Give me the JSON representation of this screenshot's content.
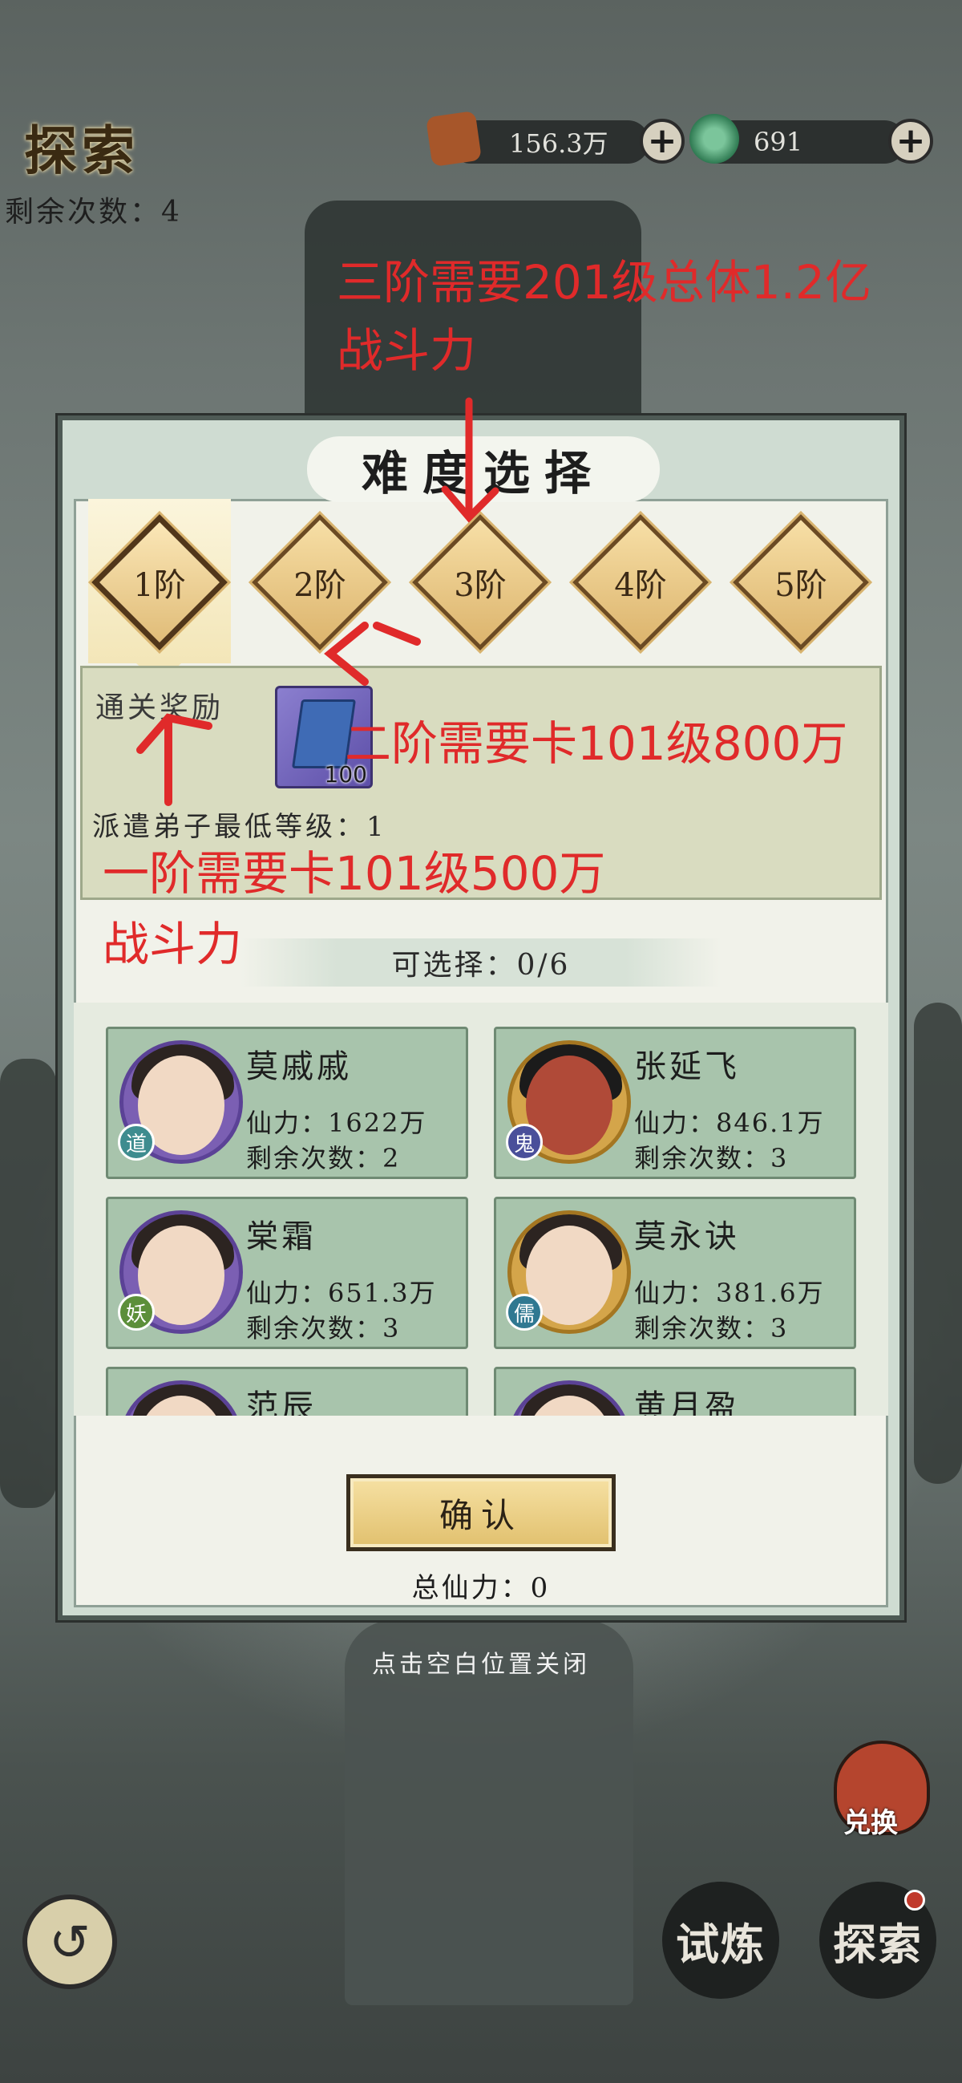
{
  "header": {
    "title": "探索",
    "remaining_label": "剩余次数：4",
    "resource1_value": "156.3万",
    "resource2_value": "691",
    "plus_symbol": "+"
  },
  "dialog": {
    "title": "难度选择",
    "tiers": [
      "1阶",
      "2阶",
      "3阶",
      "4阶",
      "5阶"
    ],
    "selected_tier": "1阶",
    "reward_label": "通关奖励",
    "reward_item_count": "100",
    "min_level_label": "派遣弟子最低等级：1",
    "selectable_label": "可选择：0/6",
    "characters": [
      {
        "name": "莫戚戚",
        "power": "仙力：1622万",
        "remaining": "剩余次数：2",
        "badge": "道"
      },
      {
        "name": "张延飞",
        "power": "仙力：846.1万",
        "remaining": "剩余次数：3",
        "badge": "鬼"
      },
      {
        "name": "棠霜",
        "power": "仙力：651.3万",
        "remaining": "剩余次数：3",
        "badge": "妖"
      },
      {
        "name": "莫永诀",
        "power": "仙力：381.6万",
        "remaining": "剩余次数：3",
        "badge": "儒"
      },
      {
        "name": "范辰",
        "power": "",
        "remaining": "",
        "badge": ""
      },
      {
        "name": "黄月盈",
        "power": "",
        "remaining": "",
        "badge": ""
      }
    ],
    "confirm_label": "确认",
    "total_power_label": "总仙力：0",
    "close_hint": "点击空白位置关闭"
  },
  "bottom": {
    "back_symbol": "↺",
    "trial_label": "试炼",
    "explore_label": "探索",
    "bag_label": "兑换"
  },
  "annotations": {
    "tier3_line1": "三阶需要201级总体1.2亿",
    "tier3_line2": "战斗力",
    "tier2": "二阶需要卡101级800万",
    "tier1_line1": "一阶需要卡101级500万",
    "tier1_line2": "战斗力"
  },
  "colors": {
    "annotation_red": "#e02a2a",
    "card_green": "#a8c4ac",
    "tier_gold": "#e0bc78",
    "avatar_purple": "#7b5fb3"
  }
}
